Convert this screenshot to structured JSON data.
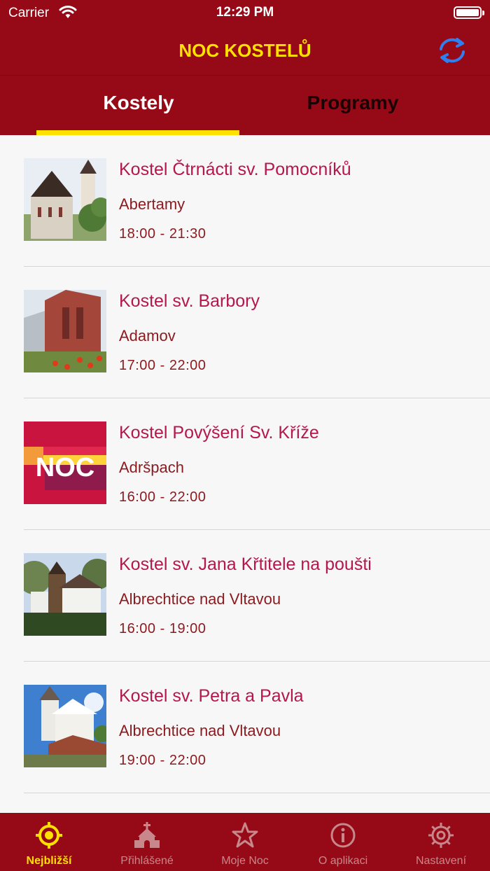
{
  "status_bar": {
    "carrier": "Carrier",
    "time": "12:29 PM"
  },
  "nav": {
    "title": "NOC KOSTELŮ",
    "refresh_icon": "refresh-icon"
  },
  "tabs": [
    {
      "label": "Kostely",
      "active": true
    },
    {
      "label": "Programy",
      "active": false
    }
  ],
  "churches": [
    {
      "name": "Kostel Čtrnácti sv. Pomocníků",
      "place": "Abertamy",
      "time": "18:00 - 21:30"
    },
    {
      "name": "Kostel sv. Barbory",
      "place": "Adamov",
      "time": "17:00 - 22:00"
    },
    {
      "name": "Kostel Povýšení Sv. Kříže",
      "place": "Adršpach",
      "time": "16:00 - 22:00",
      "thumb_text": "NOC"
    },
    {
      "name": "Kostel sv. Jana Křtitele na poušti",
      "place": "Albrechtice nad Vltavou",
      "time": "16:00 - 19:00"
    },
    {
      "name": "Kostel sv. Petra a Pavla",
      "place": "Albrechtice nad Vltavou",
      "time": "19:00 - 22:00"
    }
  ],
  "tabbar": [
    {
      "label": "Nejbližší",
      "icon": "target-icon",
      "active": true
    },
    {
      "label": "Přihlášené",
      "icon": "church-icon",
      "active": false
    },
    {
      "label": "Moje Noc",
      "icon": "star-icon",
      "active": false
    },
    {
      "label": "O aplikaci",
      "icon": "info-icon",
      "active": false
    },
    {
      "label": "Nastavení",
      "icon": "gear-icon",
      "active": false
    }
  ],
  "colors": {
    "brand_red": "#950a16",
    "accent_yellow": "#ffe100",
    "title_pink": "#b5174d",
    "refresh_blue": "#2f7ff0"
  }
}
